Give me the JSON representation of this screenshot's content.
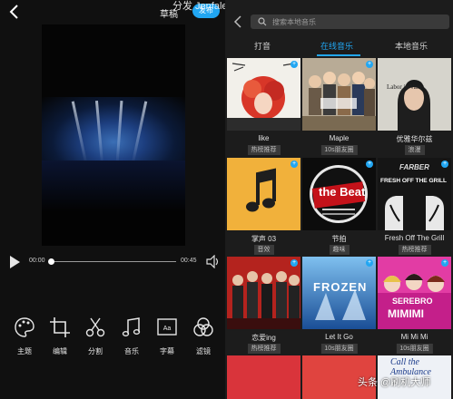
{
  "editor": {
    "title": "草稿",
    "publish_label": "发布",
    "watermark": "分发 Jenfale.com",
    "time_start": "00:00",
    "time_end": "00:45",
    "progress": 0,
    "tools": [
      {
        "label": "主题",
        "icon": "palette-icon"
      },
      {
        "label": "编辑",
        "icon": "crop-icon"
      },
      {
        "label": "分割",
        "icon": "scissors-icon"
      },
      {
        "label": "音乐",
        "icon": "music-note-icon"
      },
      {
        "label": "字幕",
        "icon": "subtitle-icon"
      },
      {
        "label": "滤镜",
        "icon": "filter-icon"
      }
    ]
  },
  "music": {
    "search_placeholder": "搜索本地音乐",
    "tabs": [
      {
        "label": "打音",
        "active": false
      },
      {
        "label": "在线音乐",
        "active": true
      },
      {
        "label": "本地音乐",
        "active": false
      }
    ],
    "cards": [
      {
        "title": "like",
        "tag": "热榜推荐"
      },
      {
        "title": "Maple",
        "tag": "10s朋友圈"
      },
      {
        "title": "优雅华尔兹",
        "tag": "浪漫"
      },
      {
        "title": "掌声 03",
        "tag": "音效"
      },
      {
        "title": "节拍",
        "tag": "趣味"
      },
      {
        "title": "Fresh Off The Grill",
        "tag": "热榜推荐"
      },
      {
        "title": "恋爱ing",
        "tag": "热榜推荐"
      },
      {
        "title": "Let It Go",
        "tag": "10s朋友圈"
      },
      {
        "title": "Mi Mi Mi",
        "tag": "10s朋友圈"
      }
    ],
    "cover_text": {
      "c3": "Labor in Vain",
      "c5": "the Beat",
      "c6a": "FRESH OFF THE GRILL",
      "c6b": "FARBER",
      "c8": "FROZEN",
      "c9a": "SEREBRO",
      "c9b": "MIMIMI",
      "c12": "Call the Ambulance"
    },
    "watermark": "头条 @刷机大师"
  },
  "colors": {
    "accent": "#21a6f2"
  }
}
